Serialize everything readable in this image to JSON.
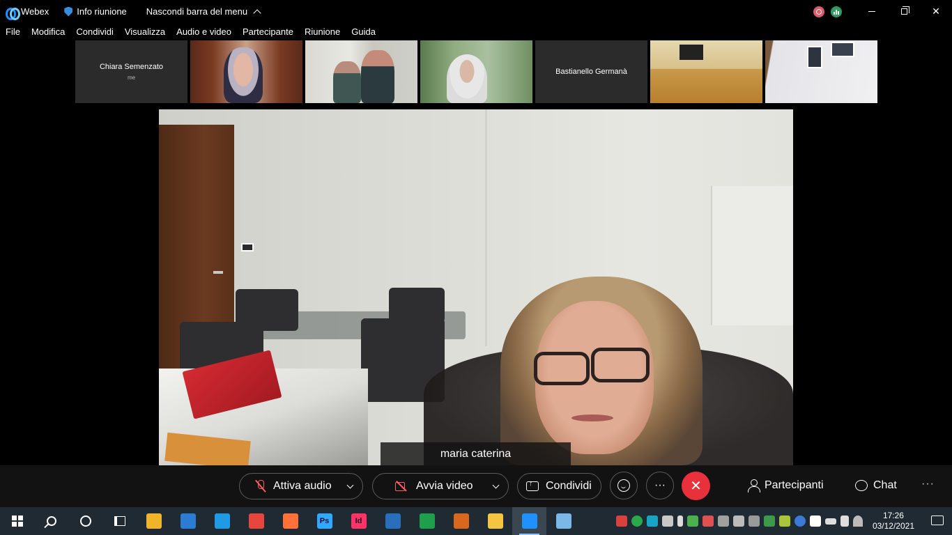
{
  "titlebar": {
    "app_name": "Webex",
    "meeting_info": "Info riunione",
    "hide_menu": "Nascondi barra del menu"
  },
  "menu": [
    "File",
    "Modifica",
    "Condividi",
    "Visualizza",
    "Audio e video",
    "Partecipante",
    "Riunione",
    "Guida"
  ],
  "thumbnails": [
    {
      "name": "Chiara Semenzato",
      "sub": "me"
    },
    {
      "name": "",
      "sub": ""
    },
    {
      "name": "",
      "sub": ""
    },
    {
      "name": "",
      "sub": ""
    },
    {
      "name": "Bastianello Germanà",
      "sub": ""
    },
    {
      "name": "",
      "sub": ""
    },
    {
      "name": "",
      "sub": ""
    }
  ],
  "main_video": {
    "speaker_name": "maria caterina"
  },
  "controls": {
    "audio_label": "Attiva audio",
    "video_label": "Avvia video",
    "share_label": "Condividi",
    "more": "···",
    "end": "✕",
    "participants_label": "Partecipanti",
    "chat_label": "Chat",
    "overflow": "···"
  },
  "taskbar": {
    "pinned_apps": [
      {
        "icon": "mail-icon",
        "color": "#2b7cd3"
      },
      {
        "icon": "edge-icon",
        "color": "#1f9be6"
      },
      {
        "icon": "chrome-icon",
        "color": "#e8453c"
      },
      {
        "icon": "firefox-icon",
        "color": "#ff7139"
      },
      {
        "icon": "photoshop-icon",
        "color": "#31a8ff",
        "label": "Ps"
      },
      {
        "icon": "indesign-icon",
        "color": "#ff3366",
        "label": "Id"
      },
      {
        "icon": "writer-icon",
        "color": "#2a6fbd"
      },
      {
        "icon": "calc-icon",
        "color": "#1e9f4b"
      },
      {
        "icon": "impress-icon",
        "color": "#d9681e"
      },
      {
        "icon": "explorer-icon",
        "color": "#f4c542"
      },
      {
        "icon": "webex-icon",
        "color": "#1e90ff"
      },
      {
        "icon": "paint-icon",
        "color": "#7ab8e8"
      }
    ],
    "time": "17:26",
    "date": "03/12/2021"
  },
  "colors": {
    "end_call": "#e8313b",
    "muted_red": "#ff5e5e",
    "taskbar": "#1f2a33",
    "control_bar": "#121212"
  }
}
